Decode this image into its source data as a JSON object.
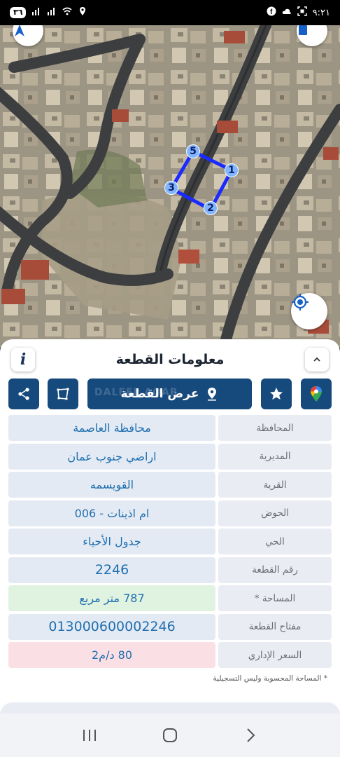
{
  "status": {
    "time": "٩:٢١",
    "battery": "٣٦"
  },
  "map": {
    "parcel_points": [
      "1",
      "2",
      "3",
      "5"
    ],
    "colors": {
      "boundary": "#1a2bff",
      "point_fill": "#7fb6ff"
    }
  },
  "sheet": {
    "title": "معلومات القطعة",
    "show_parcel_label": "عرض القطعة",
    "watermark": "DALEEL AQAR",
    "rows": [
      {
        "label": "المحافظة",
        "value": "محافظة العاصمة"
      },
      {
        "label": "المديرية",
        "value": "اراضي جنوب عمان"
      },
      {
        "label": "القرية",
        "value": "القويسمه"
      },
      {
        "label": "الحوض",
        "value": "ام اذينات - 006"
      },
      {
        "label": "الحي",
        "value": "جدول الأحياء"
      },
      {
        "label": "رقم القطعة",
        "value": "2246"
      },
      {
        "label": "المساحة *",
        "value": "787  متر مربع"
      },
      {
        "label": "مفتاح القطعة",
        "value": "013000600002246"
      },
      {
        "label": "السعر الإداري",
        "value": "80 د/م2"
      }
    ],
    "note": "* المساحة المحسوبة وليس التسجيلية"
  },
  "colors": {
    "primary": "#174a7c",
    "value_text": "#1f6fb0"
  }
}
